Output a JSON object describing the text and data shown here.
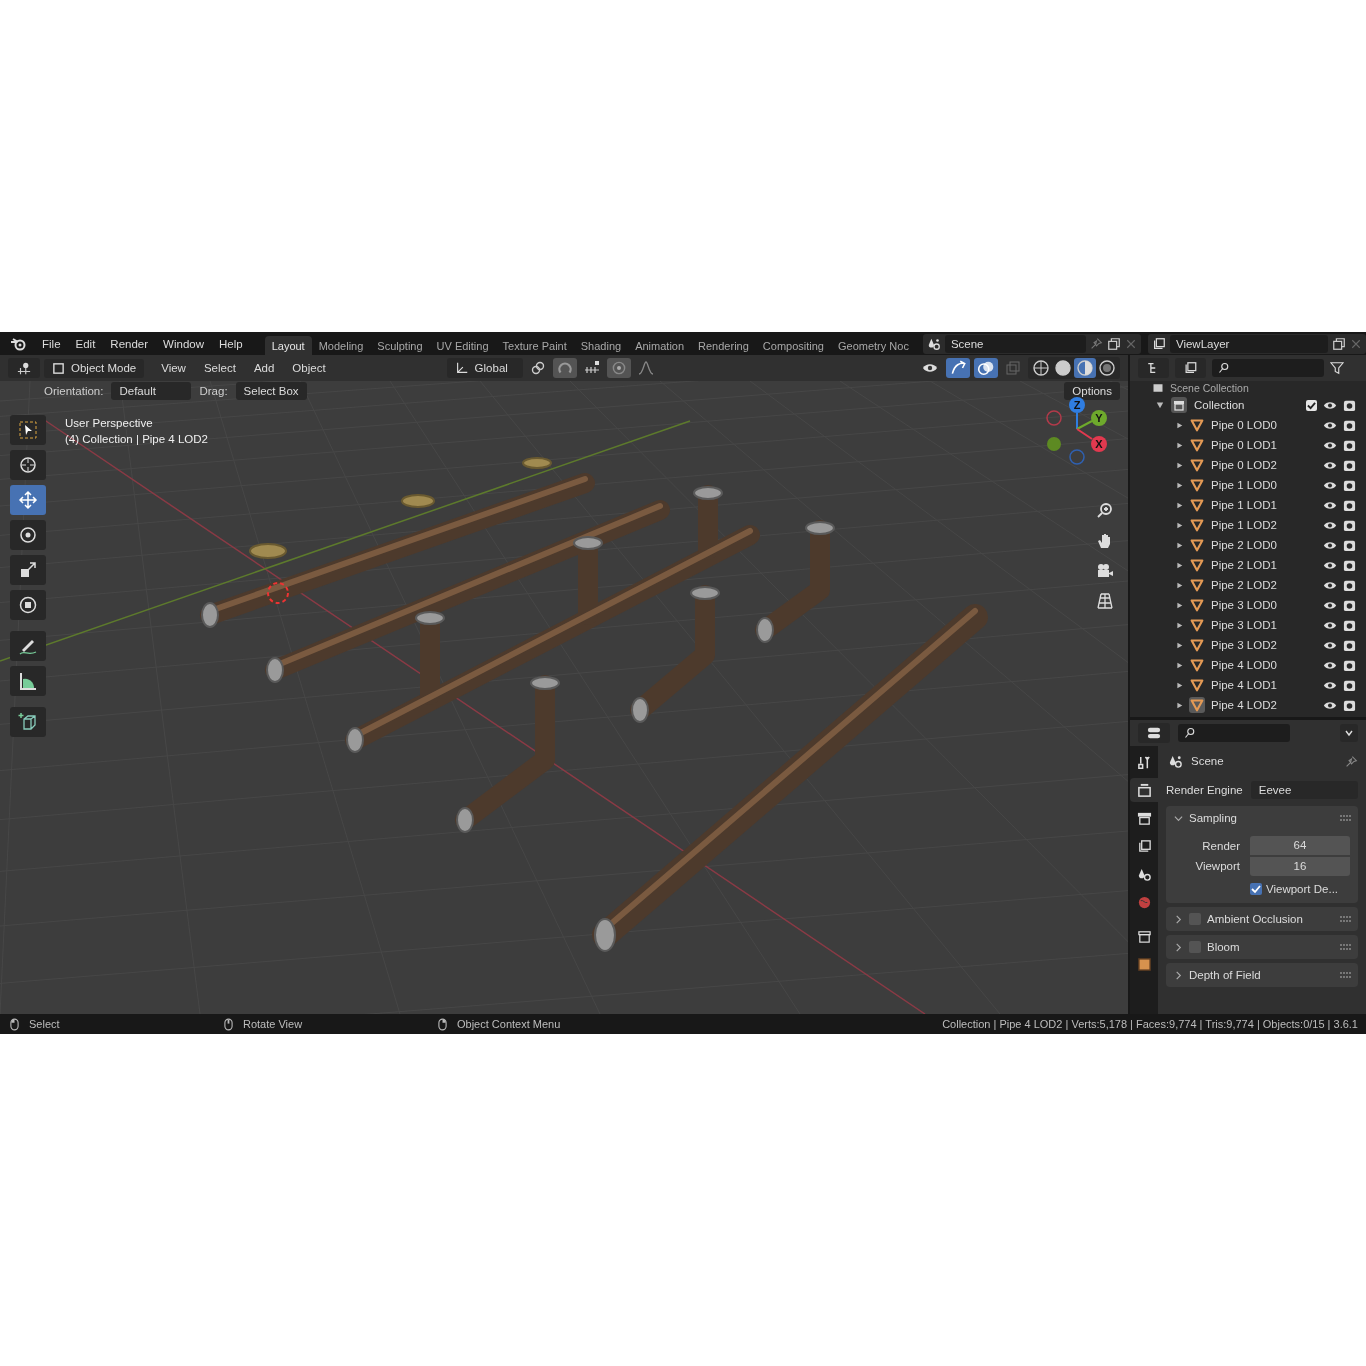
{
  "menu": [
    "File",
    "Edit",
    "Render",
    "Window",
    "Help"
  ],
  "workspaces": [
    {
      "label": "Layout",
      "selected": true
    },
    {
      "label": "Modeling",
      "selected": false
    },
    {
      "label": "Sculpting",
      "selected": false
    },
    {
      "label": "UV Editing",
      "selected": false
    },
    {
      "label": "Texture Paint",
      "selected": false
    },
    {
      "label": "Shading",
      "selected": false
    },
    {
      "label": "Animation",
      "selected": false
    },
    {
      "label": "Rendering",
      "selected": false
    },
    {
      "label": "Compositing",
      "selected": false
    },
    {
      "label": "Geometry Noc",
      "selected": false
    }
  ],
  "scene": "Scene",
  "view_layer": "ViewLayer",
  "viewport": {
    "mode": "Object Mode",
    "menus": [
      "View",
      "Select",
      "Add",
      "Object"
    ],
    "transform_orientation": "Global",
    "shading": [
      {
        "selected": false
      },
      {
        "selected": false
      },
      {
        "selected": true
      },
      {
        "selected": false
      }
    ],
    "orientation_label": "Orientation:",
    "orientation": "Default",
    "drag_label": "Drag:",
    "drag": "Select Box",
    "options": "Options",
    "tools": [
      {
        "kind": "select",
        "selected": false
      },
      {
        "kind": "cursor",
        "selected": false
      },
      {
        "kind": "move",
        "selected": true
      },
      {
        "kind": "rotate",
        "selected": false
      },
      {
        "kind": "scale",
        "selected": false
      },
      {
        "kind": "transform",
        "selected": false
      },
      {
        "kind": "annotate",
        "selected": false
      },
      {
        "kind": "measure",
        "selected": false
      },
      {
        "kind": "add",
        "selected": false
      }
    ],
    "overlay_text": [
      "User Perspective",
      "(4) Collection | Pipe 4 LOD2"
    ],
    "gizmo": [
      {
        "label": "Z",
        "color": "#2f7de1"
      },
      {
        "label": "Y",
        "color": "#6ea92c"
      },
      {
        "label": "X",
        "color": "#e2394f"
      }
    ]
  },
  "outliner": {
    "scene_collection": "Scene Collection",
    "collection": {
      "name": "Collection",
      "checked": true,
      "expanded": true,
      "children": [
        {
          "name": "Pipe 0 LOD0",
          "selected": false
        },
        {
          "name": "Pipe 0 LOD1",
          "selected": false
        },
        {
          "name": "Pipe 0 LOD2",
          "selected": false
        },
        {
          "name": "Pipe 1 LOD0",
          "selected": false
        },
        {
          "name": "Pipe 1 LOD1",
          "selected": false
        },
        {
          "name": "Pipe 1 LOD2",
          "selected": false
        },
        {
          "name": "Pipe 2 LOD0",
          "selected": false
        },
        {
          "name": "Pipe 2 LOD1",
          "selected": false
        },
        {
          "name": "Pipe 2 LOD2",
          "selected": false
        },
        {
          "name": "Pipe 3 LOD0",
          "selected": false
        },
        {
          "name": "Pipe 3 LOD1",
          "selected": false
        },
        {
          "name": "Pipe 3 LOD2",
          "selected": false
        },
        {
          "name": "Pipe 4 LOD0",
          "selected": false
        },
        {
          "name": "Pipe 4 LOD1",
          "selected": false
        },
        {
          "name": "Pipe 4 LOD2",
          "selected": true
        }
      ]
    }
  },
  "properties": {
    "tabs": [
      {
        "kind": "tool",
        "selected": false
      },
      {
        "kind": "render",
        "selected": true
      },
      {
        "kind": "output",
        "selected": false
      },
      {
        "kind": "view_layer",
        "selected": false
      },
      {
        "kind": "scene",
        "selected": false
      },
      {
        "kind": "world",
        "selected": false
      },
      {
        "kind": "collection",
        "selected": false
      },
      {
        "kind": "object",
        "selected": false
      }
    ],
    "context": "Scene",
    "render_engine_label": "Render Engine",
    "render_engine": "Eevee",
    "panels": [
      {
        "title": "Sampling",
        "kind": "plain",
        "expanded": true,
        "fields": [
          {
            "label": "Render",
            "value": "64"
          },
          {
            "label": "Viewport",
            "value": "16"
          }
        ],
        "option": {
          "label": "Viewport De...",
          "checked": true
        }
      },
      {
        "title": "Ambient Occlusion",
        "kind": "toggle",
        "checked": false,
        "expanded": false
      },
      {
        "title": "Bloom",
        "kind": "toggle",
        "checked": false,
        "expanded": false
      },
      {
        "title": "Depth of Field",
        "kind": "plain",
        "expanded": false
      }
    ]
  },
  "status_bar": {
    "hints": [
      "Select",
      "Rotate View",
      "Object Context Menu"
    ],
    "stats": "Collection | Pipe 4 LOD2 | Verts:5,178 | Faces:9,774 | Tris:9,774 | Objects:0/15 | 3.6.1"
  }
}
